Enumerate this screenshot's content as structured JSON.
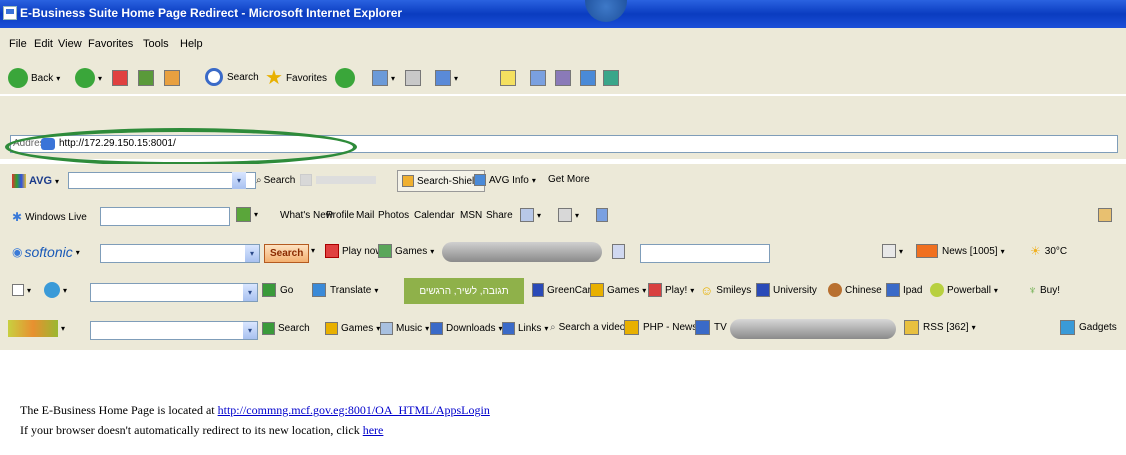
{
  "window": {
    "title": "E-Business Suite Home Page Redirect - Microsoft Internet Explorer"
  },
  "menu": [
    "File",
    "Edit",
    "View",
    "Favorites",
    "Tools",
    "Help"
  ],
  "standard_toolbar": {
    "back": "Back",
    "search": "Search",
    "favorites": "Favorites"
  },
  "address_bar": {
    "label": "Address",
    "url": "http://172.29.150.15:8001/"
  },
  "avg_toolbar": {
    "brand": "AVG",
    "search": "Search",
    "search_shield": "Search-Shield",
    "avg_info": "AVG Info",
    "get_more": "Get More"
  },
  "windows_live_toolbar": {
    "brand": "Windows Live",
    "links": [
      "What's New",
      "Profile",
      "Mail",
      "Photos",
      "Calendar",
      "MSN",
      "Share"
    ]
  },
  "softonic_toolbar": {
    "brand": "softonic",
    "search": "Search",
    "play_now": "Play now!",
    "games": "Games",
    "news": "News [1005]",
    "weather": "30°C"
  },
  "incredibar_toolbar": {
    "go": "Go",
    "translate": "Translate",
    "hebrew": "תגובה, לשיר, הרגשים",
    "links": [
      "GreenCard",
      "Games",
      "Play!",
      "Smileys",
      "University",
      "Chinese",
      "Ipad",
      "Powerball",
      "Buy!"
    ]
  },
  "media_toolbar": {
    "search": "Search",
    "links": [
      "Games",
      "Music",
      "Downloads",
      "Links"
    ],
    "search_video": "Search a video",
    "php_news": "PHP - News",
    "tv": "TV",
    "rss": "RSS [362]",
    "gadgets": "Gadgets"
  },
  "page": {
    "line1_prefix": "The E-Business Home Page is located at",
    "line1_link": "http://commng.mcf.gov.eg:8001/OA_HTML/AppsLogin",
    "line2_prefix": "If your browser doesn't automatically redirect to its new location, click",
    "line2_link": "here"
  },
  "colors": {
    "title_bar": "#0a3cc0",
    "toolbar_bg": "#ece9d8",
    "highlight": "#2e8b3a",
    "link": "#0000cc"
  }
}
